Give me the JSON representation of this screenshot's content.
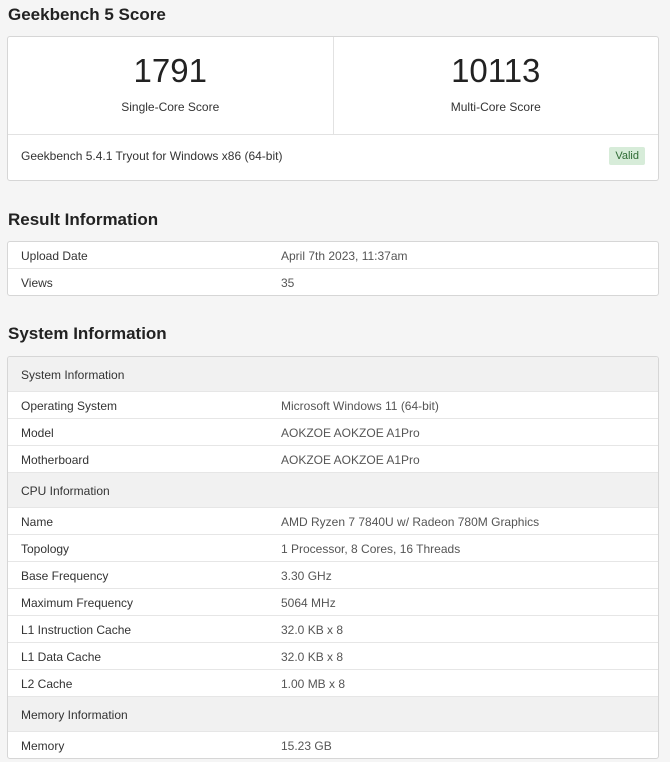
{
  "score_section": {
    "heading": "Geekbench 5 Score",
    "single": {
      "value": "1791",
      "label": "Single-Core Score"
    },
    "multi": {
      "value": "10113",
      "label": "Multi-Core Score"
    },
    "version": "Geekbench 5.4.1 Tryout for Windows x86 (64-bit)",
    "status": "Valid"
  },
  "result_info": {
    "heading": "Result Information",
    "rows": [
      {
        "key": "Upload Date",
        "value": "April 7th 2023, 11:37am"
      },
      {
        "key": "Views",
        "value": "35"
      }
    ]
  },
  "system_info": {
    "heading": "System Information",
    "groups": [
      {
        "title": "System Information",
        "rows": [
          {
            "key": "Operating System",
            "value": "Microsoft Windows 11 (64-bit)"
          },
          {
            "key": "Model",
            "value": "AOKZOE AOKZOE A1Pro"
          },
          {
            "key": "Motherboard",
            "value": "AOKZOE AOKZOE A1Pro"
          }
        ]
      },
      {
        "title": "CPU Information",
        "rows": [
          {
            "key": "Name",
            "value": "AMD Ryzen 7 7840U w/ Radeon 780M Graphics"
          },
          {
            "key": "Topology",
            "value": "1 Processor, 8 Cores, 16 Threads"
          },
          {
            "key": "Base Frequency",
            "value": "3.30 GHz"
          },
          {
            "key": "Maximum Frequency",
            "value": "5064 MHz"
          },
          {
            "key": "L1 Instruction Cache",
            "value": "32.0 KB x 8"
          },
          {
            "key": "L1 Data Cache",
            "value": "32.0 KB x 8"
          },
          {
            "key": "L2 Cache",
            "value": "1.00 MB x 8"
          }
        ]
      },
      {
        "title": "Memory Information",
        "rows": [
          {
            "key": "Memory",
            "value": "15.23 GB"
          }
        ]
      }
    ]
  }
}
